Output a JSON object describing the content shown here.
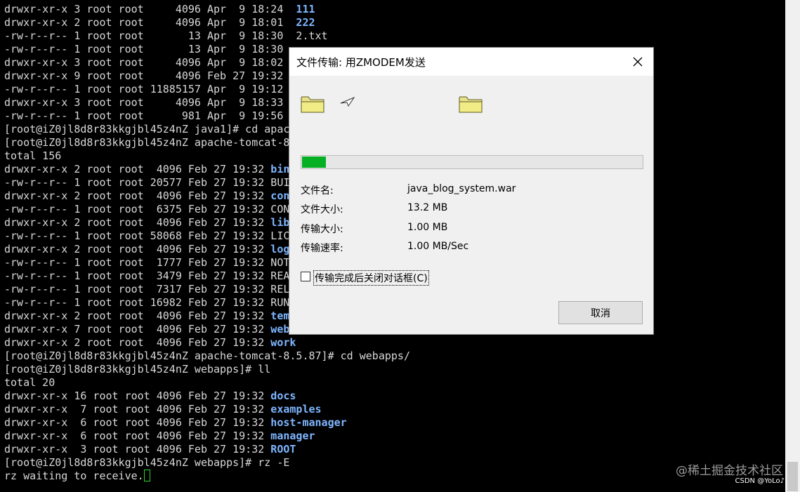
{
  "terminal": {
    "lines": [
      {
        "text": "drwxr-xr-x 3 root root     4096 Apr  9 18:24  ",
        "name": "111"
      },
      {
        "text": "drwxr-xr-x 2 root root     4096 Apr  9 18:01  ",
        "name": "222"
      },
      {
        "text": "-rw-r--r-- 1 root root       13 Apr  9 18:30  2.txt",
        "name": ""
      },
      {
        "text": "-rw-r--r-- 1 root root       13 Apr  9 18:30  ",
        "name": ""
      },
      {
        "text": "drwxr-xr-x 3 root root     4096 Apr  9 18:02  ",
        "name": ""
      },
      {
        "text": "drwxr-xr-x 9 root root     4096 Feb 27 19:32  ",
        "name": ""
      },
      {
        "text": "-rw-r--r-- 1 root root 11885157 Apr  9 19:12  ",
        "name": ""
      },
      {
        "text": "drwxr-xr-x 3 root root     4096 Apr  9 18:33  ",
        "name": ""
      },
      {
        "text": "-rw-r--r-- 1 root root      981 Apr  9 19:56  ",
        "name": ""
      },
      {
        "text": "[root@iZ0jl8d8r83kkgjbl45z4nZ java1]# cd apac",
        "name": ""
      },
      {
        "text": "[root@iZ0jl8d8r83kkgjbl45z4nZ apache-tomcat-8",
        "name": ""
      },
      {
        "text": "total 156",
        "name": ""
      },
      {
        "text": "drwxr-xr-x 2 root root  4096 Feb 27 19:32 ",
        "name": "bin"
      },
      {
        "text": "-rw-r--r-- 1 root root 20577 Feb 27 19:32 BUI",
        "name": ""
      },
      {
        "text": "drwxr-xr-x 2 root root  4096 Feb 27 19:32 ",
        "name": "con"
      },
      {
        "text": "-rw-r--r-- 1 root root  6375 Feb 27 19:32 CON",
        "name": ""
      },
      {
        "text": "drwxr-xr-x 2 root root  4096 Feb 27 19:32 ",
        "name": "lib"
      },
      {
        "text": "-rw-r--r-- 1 root root 58068 Feb 27 19:32 LIC",
        "name": ""
      },
      {
        "text": "drwxr-xr-x 2 root root  4096 Feb 27 19:32 ",
        "name": "log"
      },
      {
        "text": "-rw-r--r-- 1 root root  1777 Feb 27 19:32 NOT",
        "name": ""
      },
      {
        "text": "-rw-r--r-- 1 root root  3479 Feb 27 19:32 REA",
        "name": ""
      },
      {
        "text": "-rw-r--r-- 1 root root  7317 Feb 27 19:32 REL",
        "name": ""
      },
      {
        "text": "-rw-r--r-- 1 root root 16982 Feb 27 19:32 RUN",
        "name": ""
      },
      {
        "text": "drwxr-xr-x 2 root root  4096 Feb 27 19:32 ",
        "name": "tem"
      },
      {
        "text": "drwxr-xr-x 7 root root  4096 Feb 27 19:32 ",
        "name": "web"
      },
      {
        "text": "drwxr-xr-x 2 root root  4096 Feb 27 19:32 ",
        "name": "work"
      },
      {
        "text": "[root@iZ0jl8d8r83kkgjbl45z4nZ apache-tomcat-8.5.87]# cd webapps/",
        "name": ""
      },
      {
        "text": "[root@iZ0jl8d8r83kkgjbl45z4nZ webapps]# ll",
        "name": ""
      },
      {
        "text": "total 20",
        "name": ""
      },
      {
        "text": "drwxr-xr-x 16 root root 4096 Feb 27 19:32 ",
        "name": "docs"
      },
      {
        "text": "drwxr-xr-x  7 root root 4096 Feb 27 19:32 ",
        "name": "examples"
      },
      {
        "text": "drwxr-xr-x  6 root root 4096 Feb 27 19:32 ",
        "name": "host-manager"
      },
      {
        "text": "drwxr-xr-x  6 root root 4096 Feb 27 19:32 ",
        "name": "manager"
      },
      {
        "text": "drwxr-xr-x  3 root root 4096 Feb 27 19:32 ",
        "name": "ROOT"
      },
      {
        "text": "[root@iZ0jl8d8r83kkgjbl45z4nZ webapps]# rz -E",
        "name": ""
      },
      {
        "text": "rz waiting to receive.",
        "name": ""
      }
    ],
    "colors": {
      "background": "#000000",
      "text": "#d8d8d8",
      "directory": "#7fb6ff",
      "cursor": "#2fd22f"
    }
  },
  "dialog": {
    "title": "文件传输: 用ZMODEM发送",
    "close_icon": "close-icon",
    "progress": 0.07,
    "progress_color": "#06b025",
    "fields": [
      {
        "label": "文件名:",
        "value": "java_blog_system.war"
      },
      {
        "label": "文件大小:",
        "value": "13.2 MB"
      },
      {
        "label": "传输大小:",
        "value": "1.00 MB"
      },
      {
        "label": "传输速率:",
        "value": "1.00 MB/Sec"
      }
    ],
    "checkbox_label": "传输完成后关闭对话框(C)",
    "checkbox_checked": false,
    "cancel_label": "取消"
  },
  "watermark": "@稀土掘金技术社区",
  "csdn_mark": "CSDN @YoLo♪"
}
